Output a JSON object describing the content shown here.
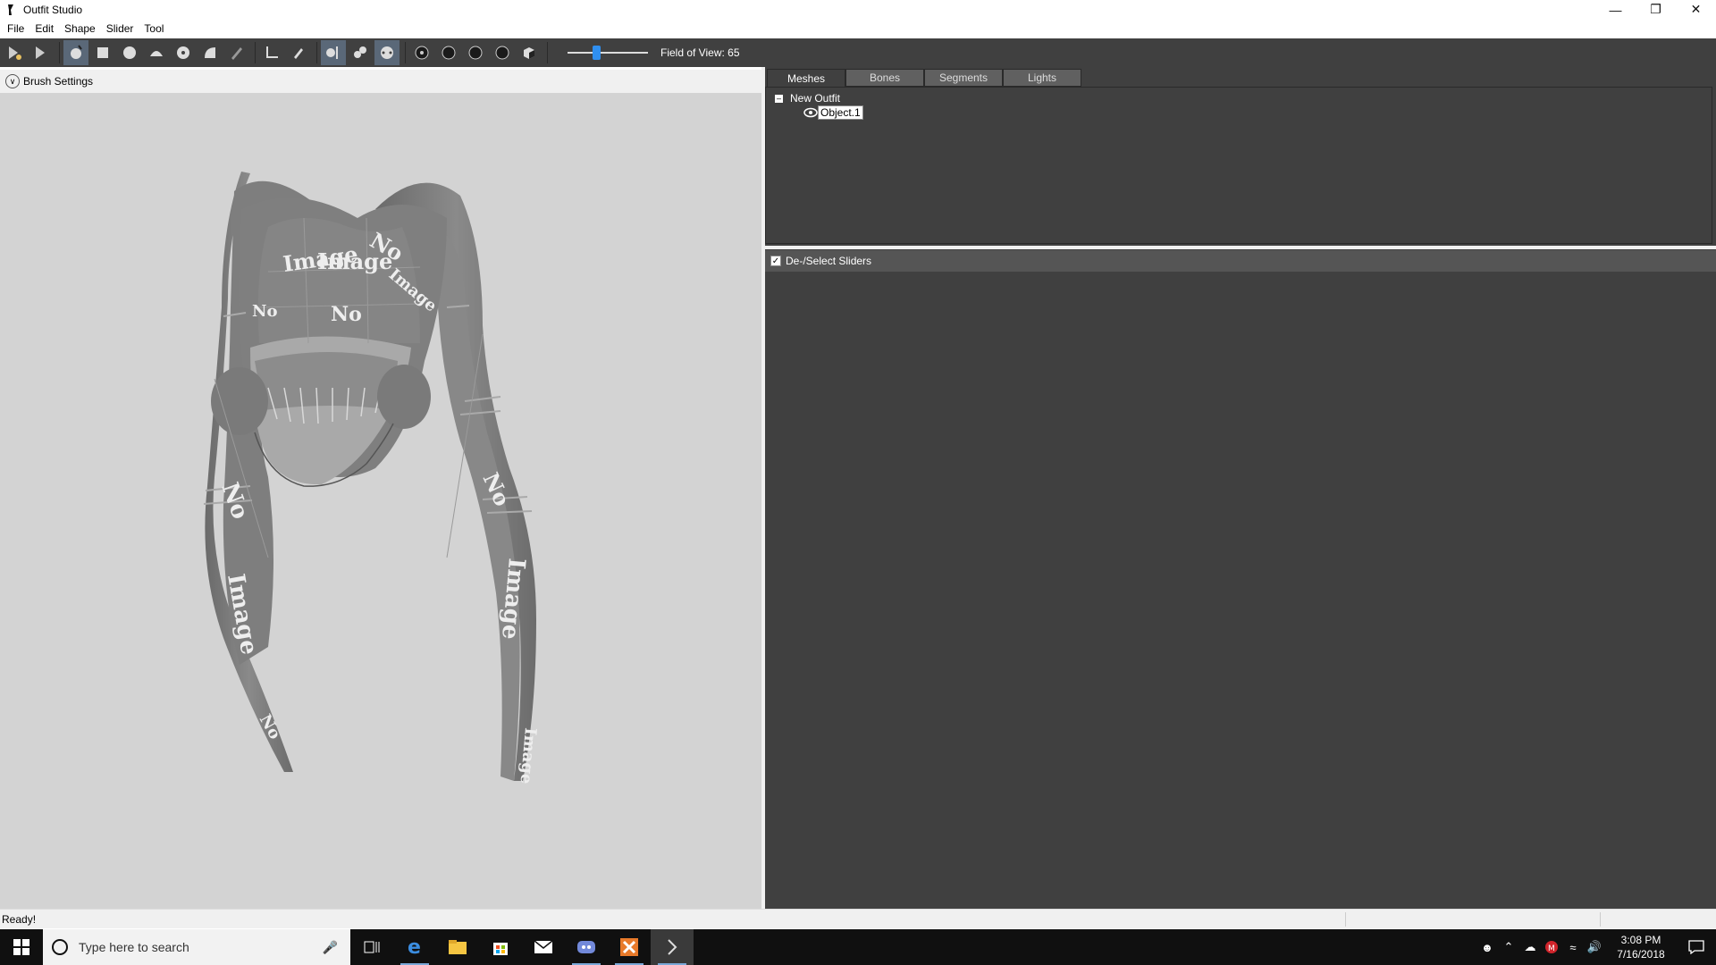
{
  "window": {
    "title": "Outfit Studio"
  },
  "menu": {
    "items": [
      "File",
      "Edit",
      "Shape",
      "Slider",
      "Tool"
    ]
  },
  "toolbar": {
    "fov_label": "Field of View: 65",
    "fov_slider_level": 0.34
  },
  "brush": {
    "label": "Brush Settings"
  },
  "viewport": {
    "texture_words": [
      "Image",
      "Image",
      "No",
      "No",
      "No",
      "Image",
      "No",
      "Image",
      "No",
      "Image",
      "No",
      "Image"
    ]
  },
  "right_panel": {
    "tabs": [
      "Meshes",
      "Bones",
      "Segments",
      "Lights"
    ],
    "active_tab": "Meshes",
    "tree": {
      "root": "New Outfit",
      "child": "Object.1"
    },
    "sliders_toggle_label": "De-/Select Sliders"
  },
  "status": {
    "text": "Ready!"
  },
  "taskbar": {
    "search_placeholder": "Type here to search",
    "time": "3:08 PM",
    "date": "7/16/2018"
  }
}
